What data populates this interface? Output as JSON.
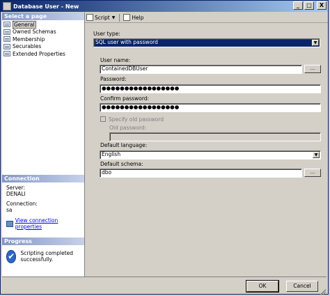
{
  "window": {
    "title": "Database User - New",
    "buttons": {
      "minimize": "_",
      "maximize": "□",
      "close": "X"
    }
  },
  "sidebar": {
    "header": "Select a page",
    "pages": [
      {
        "label": "General",
        "icon": "page-icon",
        "selected": true
      },
      {
        "label": "Owned Schemas",
        "icon": "page-icon"
      },
      {
        "label": "Membership",
        "icon": "page-icon"
      },
      {
        "label": "Securables",
        "icon": "page-icon"
      },
      {
        "label": "Extended Properties",
        "icon": "page-icon"
      }
    ]
  },
  "connection": {
    "header": "Connection",
    "server_label": "Server:",
    "server_value": "DENALI",
    "connection_label": "Connection:",
    "connection_value": "sa",
    "link": "View connection properties"
  },
  "progress": {
    "header": "Progress",
    "status": "Scripting completed successfully.",
    "icon": "check-circle-icon"
  },
  "toolbar": {
    "script_label": "Script",
    "help_label": "Help"
  },
  "form": {
    "user_type_label": "User type:",
    "user_type_value": "SQL user with password",
    "user_name_label": "User name:",
    "user_name_value": "ContainedDBUser",
    "password_label": "Password:",
    "password_value": "●●●●●●●●●●●●●●●●●",
    "confirm_password_label": "Confirm password:",
    "confirm_password_value": "●●●●●●●●●●●●●●●●●",
    "specify_old_label": "Specify old password",
    "old_password_label": "Old password:",
    "default_language_label": "Default language:",
    "default_language_value": "English",
    "default_schema_label": "Default schema:",
    "default_schema_value": "dbo",
    "ellipsis": "..."
  },
  "footer": {
    "ok": "OK",
    "cancel": "Cancel"
  },
  "colors": {
    "title_bar": "#0a246a",
    "section_header": "#8497c4",
    "selection": "#0a246a",
    "window_bg": "#d4d0c8"
  }
}
